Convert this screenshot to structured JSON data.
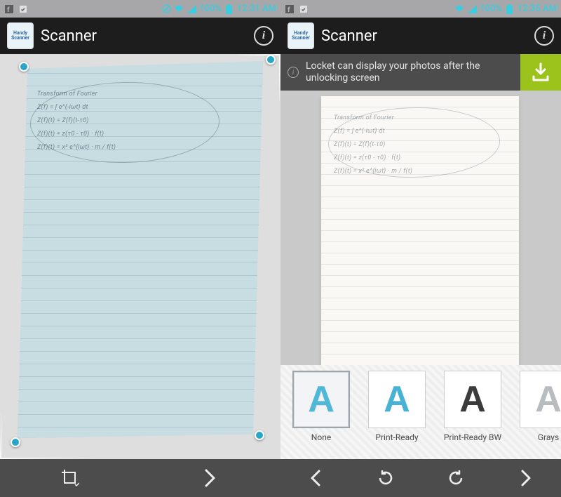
{
  "left": {
    "statusbar": {
      "battery_pct": "100%",
      "time": "12:31 AM"
    },
    "appbar": {
      "logo_line1": "Handy",
      "logo_line2": "Scanner",
      "title": "Scanner"
    },
    "page": {
      "writing_lines": [
        "Transform of Fourier",
        "Z(f) = ∫ e^{-iωt} dt",
        "Z(f)(t) = Z(f)(t-τ0)",
        "Z(f)(t) = z(τ0 - τ0) · f(t)",
        "Z(f)(t) = x² e^{iωt} · m / f(t)"
      ]
    },
    "toolbar": {
      "crop_label": "Crop",
      "next_label": "Next"
    }
  },
  "right": {
    "statusbar": {
      "battery_pct": "100%",
      "time": "12:35 AM"
    },
    "appbar": {
      "logo_line1": "Handy",
      "logo_line2": "Scanner",
      "title": "Scanner"
    },
    "banner": {
      "text": "Locket can display your photos after the unlocking screen",
      "action": "Download"
    },
    "filters": [
      {
        "letter": "A",
        "label": "None",
        "selected": true,
        "swatchClass": "c1"
      },
      {
        "letter": "A",
        "label": "Print-Ready",
        "selected": false,
        "swatchClass": "c2"
      },
      {
        "letter": "A",
        "label": "Print-Ready BW",
        "selected": false,
        "swatchClass": "c3"
      },
      {
        "letter": "A",
        "label": "Grays",
        "selected": false,
        "swatchClass": "c4"
      }
    ],
    "toolbar": {
      "prev_label": "Previous",
      "rotate_ccw_label": "Rotate left",
      "rotate_cw_label": "Rotate right",
      "next_label": "Next"
    }
  }
}
